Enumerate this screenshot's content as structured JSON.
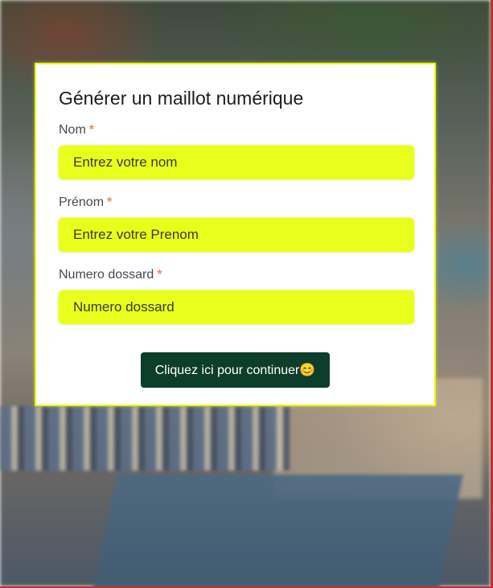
{
  "form": {
    "title": "Générer un maillot numérique",
    "fields": [
      {
        "label": "Nom",
        "required_mark": "*",
        "placeholder": "Entrez votre nom"
      },
      {
        "label": "Prénom",
        "required_mark": "*",
        "placeholder": "Entrez votre Prenom"
      },
      {
        "label": "Numero dossard",
        "required_mark": "*",
        "placeholder": "Numero dossard"
      }
    ],
    "submit_label": "Cliquez ici pour continuer😊"
  },
  "colors": {
    "input_bg": "#e8ff1c",
    "button_bg": "#0d3d2b",
    "required": "#f08a5d",
    "card_border": "#e6f51a"
  }
}
